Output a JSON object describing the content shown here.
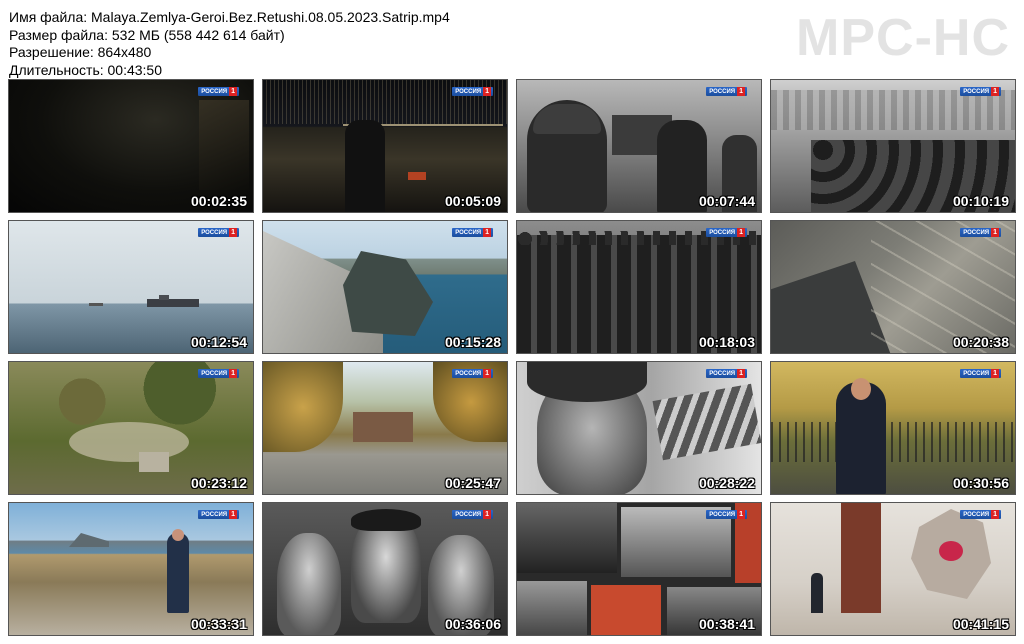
{
  "file_info": {
    "name_line": "Имя файла: Malaya.Zemlya-Geroi.Bez.Retushi.08.05.2023.Satrip.mp4",
    "size_line": "Размер файла: 532 МБ (558 442 614 байт)",
    "resolution_line": "Разрешение: 864x480",
    "duration_line": "Длительность: 00:43:50"
  },
  "logo": "MPC-HC",
  "channel": {
    "name": "РОССИЯ",
    "num": "1"
  },
  "thumbnails": [
    {
      "time": "00:02:35",
      "scene": "dark"
    },
    {
      "time": "00:05:09",
      "scene": "night-shore"
    },
    {
      "time": "00:07:44",
      "scene": "bw-soldiers-tank"
    },
    {
      "time": "00:10:19",
      "scene": "bw-troops-ship"
    },
    {
      "time": "00:12:54",
      "scene": "sea-ship"
    },
    {
      "time": "00:15:28",
      "scene": "monument-bay"
    },
    {
      "time": "00:18:03",
      "scene": "bw-soldiers-row"
    },
    {
      "time": "00:20:38",
      "scene": "aerial-photo"
    },
    {
      "time": "00:23:12",
      "scene": "aerial-hill"
    },
    {
      "time": "00:25:47",
      "scene": "autumn-park"
    },
    {
      "time": "00:28:22",
      "scene": "drawing-soldier"
    },
    {
      "time": "00:30:56",
      "scene": "presenter-park"
    },
    {
      "time": "00:33:31",
      "scene": "walker-shore"
    },
    {
      "time": "00:36:06",
      "scene": "bw-three-men"
    },
    {
      "time": "00:38:41",
      "scene": "museum-wall"
    },
    {
      "time": "00:41:15",
      "scene": "memorial-hall"
    }
  ]
}
